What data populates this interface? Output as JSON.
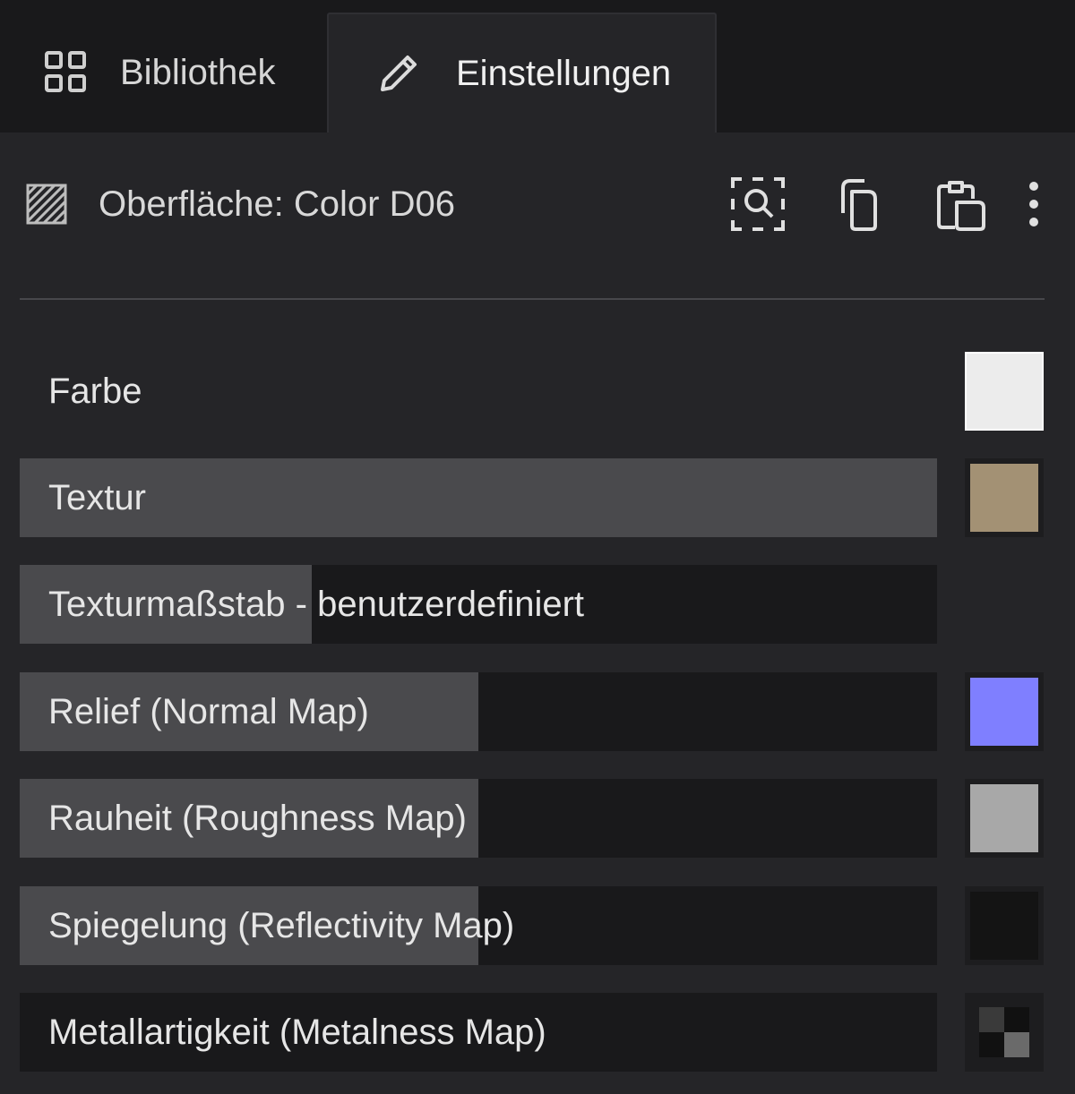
{
  "tabs": {
    "library": "Bibliothek",
    "settings": "Einstellungen"
  },
  "surface": {
    "title": "Oberfläche: Color D06"
  },
  "properties": {
    "color": {
      "label": "Farbe",
      "swatch": "#ececec"
    },
    "texture": {
      "label": "Textur",
      "swatch": "#a39174",
      "fill": 1.0
    },
    "texture_scale": {
      "label": "Texturmaßstab - benutzerdefiniert",
      "fill": 0.318
    },
    "relief": {
      "label": "Relief (Normal Map)",
      "swatch": "#7f7fff",
      "fill": 0.5
    },
    "roughness": {
      "label": "Rauheit (Roughness Map)",
      "swatch": "#a8a8a8",
      "fill": 0.5
    },
    "reflectivity": {
      "label": "Spiegelung (Reflectivity Map)",
      "swatch": "#141414",
      "fill": 0.5
    },
    "metalness": {
      "label": "Metallartigkeit (Metalness Map)",
      "swatch": "checker",
      "fill": 0.0
    }
  },
  "colors": {
    "background": "#252528",
    "tabbar": "#19191b",
    "bar_track": "#19191b",
    "bar_fill": "#4a4a4d"
  },
  "icons": {
    "library_tab": "grid-icon",
    "settings_tab": "pencil-icon",
    "surface": "hatch-pattern-icon",
    "inspect": "inspect-icon",
    "copy": "copy-icon",
    "paste": "paste-icon",
    "more": "more-vertical-icon"
  }
}
